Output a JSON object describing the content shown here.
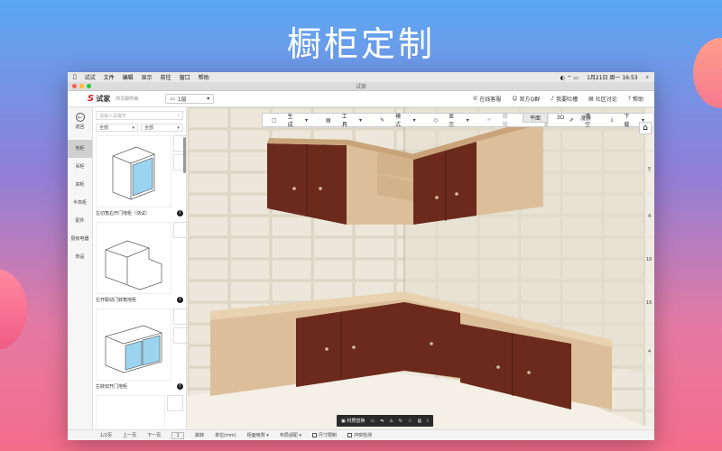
{
  "hero_title": "橱柜定制",
  "menubar": {
    "items": [
      "",
      "试试",
      "文件",
      "编辑",
      "显示",
      "前往",
      "窗口",
      "帮助"
    ],
    "clock": "1月21日 周一  16:53"
  },
  "window_title": "试家",
  "app_header": {
    "logo_mark": "S",
    "logo_name": "试家",
    "logo_slogan": "所见即所得",
    "floor_label": "1层",
    "links": [
      "在线客服",
      "官方Q群",
      "我要吐槽",
      "社区讨论",
      "帮助"
    ]
  },
  "left_nav": {
    "back_label": "返回",
    "items": [
      "地柜",
      "吊柜",
      "高柜",
      "半高柜",
      "配件",
      "厨房电器",
      "饰品"
    ]
  },
  "catalog": {
    "search_placeholder": "请输入关键字",
    "filter1": "全部",
    "filter2": "全部",
    "cards": [
      {
        "label": "左切角右开门地柜（测试）"
      },
      {
        "label": "左开联动门转角地柜"
      },
      {
        "label": "左转双开门地柜"
      }
    ]
  },
  "view_toolbar": {
    "items": [
      "生成",
      "工具",
      "模式",
      "显示",
      "撤销",
      "恢复",
      "清空",
      "下载"
    ]
  },
  "view_tabs": [
    "平面",
    "3D",
    "漫游"
  ],
  "ruler_marks": [
    "5",
    "4",
    "10",
    "15",
    "4"
  ],
  "bottom_toolbar_label": "材质替换",
  "status_bar": {
    "page": "1/2页",
    "prev": "上一页",
    "next": "下一页",
    "jump_value": "1",
    "jump": "跳转",
    "unit": "单位(mm)",
    "snap1": "柜面吸附",
    "snap2": "布局适配",
    "chk1": "尺寸限制",
    "chk2": "冲突检测"
  },
  "colors": {
    "wood_dark": "#6b2a1c",
    "wood_light": "#dcbf9a",
    "accent_red": "#d71f27"
  }
}
